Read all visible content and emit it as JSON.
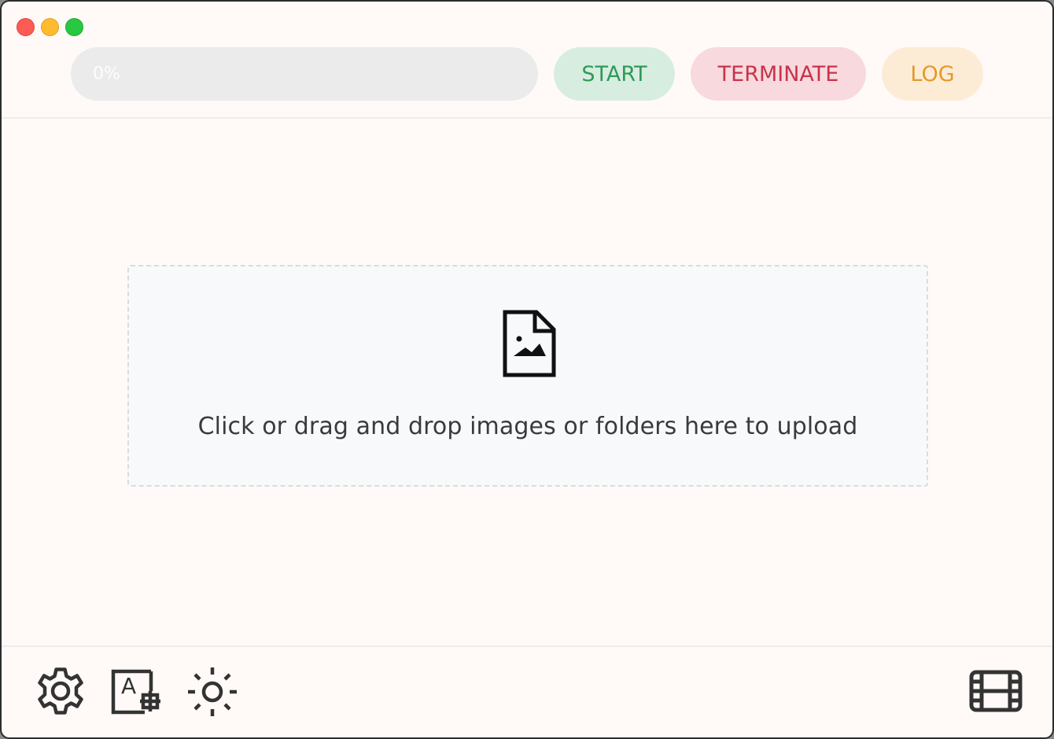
{
  "window": {
    "controls": [
      "close",
      "minimize",
      "maximize"
    ]
  },
  "toolbar": {
    "progress_text": "0%",
    "progress_value": 0,
    "start_label": "START",
    "terminate_label": "TERMINATE",
    "log_label": "LOG"
  },
  "dropzone": {
    "icon": "image-file-icon",
    "text": "Click or drag and drop images or folders here to upload"
  },
  "bottom_bar": {
    "left_icons": [
      "gear-icon",
      "text-add-icon",
      "brightness-icon"
    ],
    "right_icons": [
      "film-icon"
    ]
  },
  "colors": {
    "start_text": "#2f9a58",
    "start_bg": "#d7ede0",
    "terminate_text": "#c8334a",
    "terminate_bg": "#f8d9de",
    "log_text": "#e29a2c",
    "log_bg": "#fdecd5",
    "window_bg": "#fffaf8",
    "icon_color": "#333333"
  }
}
